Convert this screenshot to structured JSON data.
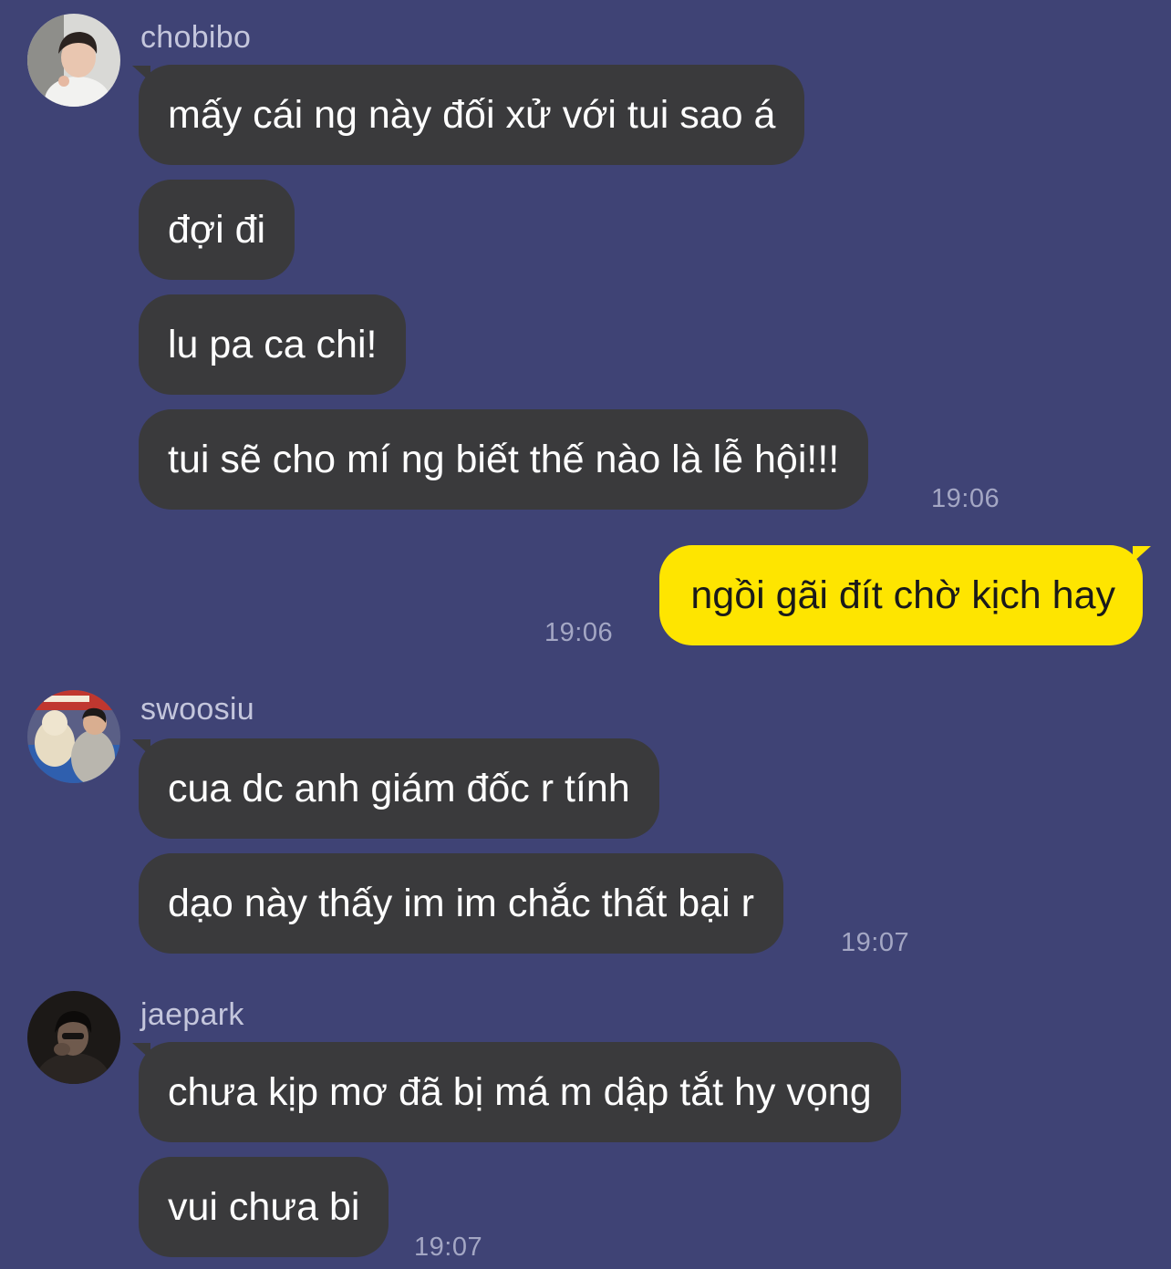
{
  "messages": [
    {
      "sender": "chobibo",
      "lines": [
        "mấy cái ng này đối xử với tui sao á",
        "đợi đi",
        "lu pa ca chi!",
        "tui sẽ cho mí ng biết thế nào là lễ hội!!!"
      ],
      "time": "19:06"
    },
    {
      "sender": "me",
      "lines": [
        "ngồi gãi đít chờ kịch hay"
      ],
      "time": "19:06"
    },
    {
      "sender": "swoosiu",
      "lines": [
        "cua dc anh giám đốc r tính",
        "dạo này thấy im im chắc thất bại r"
      ],
      "time": "19:07"
    },
    {
      "sender": "jaepark",
      "lines": [
        "chưa kịp mơ đã bị má m dập tắt hy vọng",
        "vui chưa bi"
      ],
      "time": "19:07"
    }
  ],
  "colors": {
    "background": "#3f4375",
    "incoming_bubble": "#3a3a3c",
    "outgoing_bubble": "#fee500",
    "timestamp": "#a4a7c4",
    "sender_name": "#c4c6dc"
  }
}
